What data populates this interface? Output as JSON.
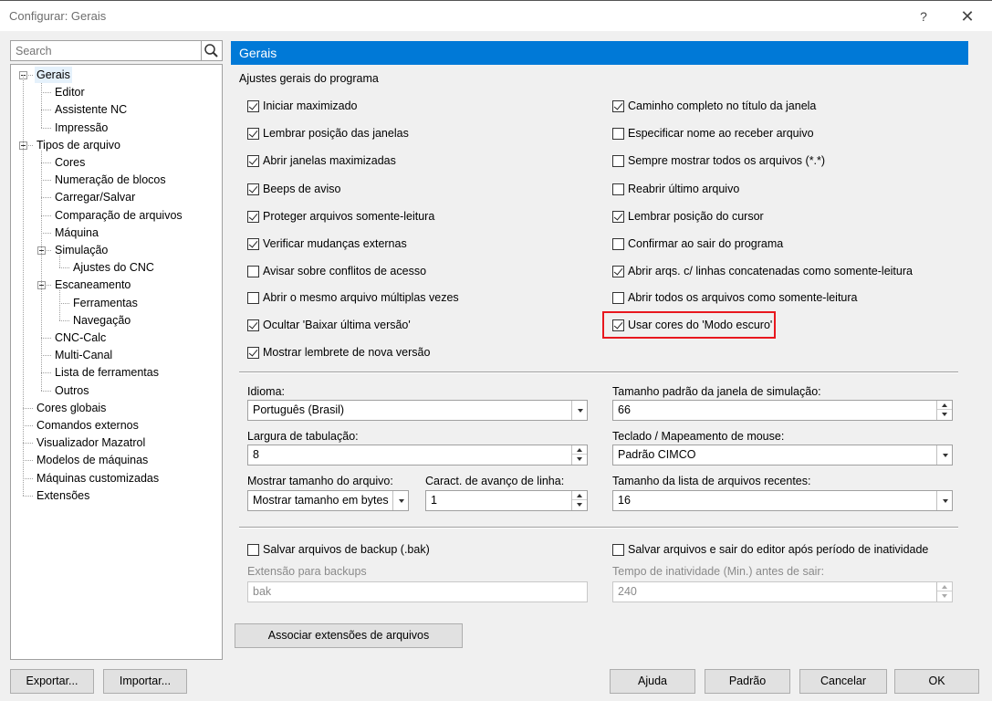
{
  "window": {
    "title": "Configurar: Gerais",
    "help": "?",
    "close": "✕"
  },
  "search": {
    "placeholder": "Search"
  },
  "tree": {
    "items": [
      {
        "label": "Gerais",
        "depth": 0,
        "expander": true,
        "selected": true
      },
      {
        "label": "Editor",
        "depth": 1
      },
      {
        "label": "Assistente NC",
        "depth": 1
      },
      {
        "label": "Impressão",
        "depth": 1
      },
      {
        "label": "Tipos de arquivo",
        "depth": 0,
        "expander": true
      },
      {
        "label": "Cores",
        "depth": 1
      },
      {
        "label": "Numeração de blocos",
        "depth": 1
      },
      {
        "label": "Carregar/Salvar",
        "depth": 1
      },
      {
        "label": "Comparação de arquivos",
        "depth": 1
      },
      {
        "label": "Máquina",
        "depth": 1
      },
      {
        "label": "Simulação",
        "depth": 1,
        "expander": true
      },
      {
        "label": "Ajustes do CNC",
        "depth": 2
      },
      {
        "label": "Escaneamento",
        "depth": 1,
        "expander": true
      },
      {
        "label": "Ferramentas",
        "depth": 2
      },
      {
        "label": "Navegação",
        "depth": 2
      },
      {
        "label": "CNC-Calc",
        "depth": 1
      },
      {
        "label": "Multi-Canal",
        "depth": 1
      },
      {
        "label": "Lista de ferramentas",
        "depth": 1
      },
      {
        "label": "Outros",
        "depth": 1
      },
      {
        "label": "Cores globais",
        "depth": 0
      },
      {
        "label": "Comandos externos",
        "depth": 0
      },
      {
        "label": "Visualizador Mazatrol",
        "depth": 0
      },
      {
        "label": "Modelos de máquinas",
        "depth": 0
      },
      {
        "label": "Máquinas customizadas",
        "depth": 0
      },
      {
        "label": "Extensões",
        "depth": 0
      }
    ]
  },
  "panel": {
    "header": "Gerais",
    "section_label": "Ajustes gerais do programa",
    "left_checks": [
      {
        "label": "Iniciar maximizado",
        "checked": true
      },
      {
        "label": "Lembrar posição das janelas",
        "checked": true
      },
      {
        "label": "Abrir janelas maximizadas",
        "checked": true
      },
      {
        "label": "Beeps de aviso",
        "checked": true
      },
      {
        "label": "Proteger arquivos somente-leitura",
        "checked": true
      },
      {
        "label": "Verificar mudanças externas",
        "checked": true
      },
      {
        "label": "Avisar sobre conflitos de acesso",
        "checked": false
      },
      {
        "label": "Abrir o mesmo arquivo múltiplas vezes",
        "checked": false
      },
      {
        "label": "Ocultar 'Baixar última versão'",
        "checked": true
      },
      {
        "label": "Mostrar lembrete de nova versão",
        "checked": true
      }
    ],
    "right_checks": [
      {
        "label": "Caminho completo no título da janela",
        "checked": true
      },
      {
        "label": "Especificar nome ao receber arquivo",
        "checked": false
      },
      {
        "label": "Sempre mostrar todos os arquivos (*.*)",
        "checked": false
      },
      {
        "label": "Reabrir último arquivo",
        "checked": false
      },
      {
        "label": "Lembrar posição do cursor",
        "checked": true
      },
      {
        "label": "Confirmar ao sair do programa",
        "checked": false
      },
      {
        "label": "Abrir arqs. c/ linhas concatenadas como somente-leitura",
        "checked": true
      },
      {
        "label": "Abrir todos os arquivos como somente-leitura",
        "checked": false
      },
      {
        "label": "Usar cores do 'Modo escuro'",
        "checked": true
      }
    ],
    "idioma": {
      "label": "Idioma:",
      "value": "Português (Brasil)"
    },
    "tab_width": {
      "label": "Largura de tabulação:",
      "value": "8"
    },
    "file_size": {
      "label": "Mostrar tamanho do arquivo:",
      "value": "Mostrar tamanho em bytes"
    },
    "line_feed": {
      "label": "Caract. de avanço de linha:",
      "value": "1"
    },
    "sim_size": {
      "label": "Tamanho padrão da janela de simulação:",
      "value": "66"
    },
    "keyboard": {
      "label": "Teclado / Mapeamento de mouse:",
      "value": "Padrão CIMCO"
    },
    "recent": {
      "label": "Tamanho da lista de arquivos recentes:",
      "value": "16"
    },
    "backup": {
      "label": "Salvar arquivos de backup (.bak)",
      "checked": false,
      "ext_label": "Extensão para backups",
      "ext_value": "bak"
    },
    "autosave": {
      "label": "Salvar arquivos e sair do editor após período de inatividade",
      "checked": false,
      "time_label": "Tempo de inatividade (Min.) antes de sair:",
      "time_value": "240"
    },
    "assoc_button": "Associar extensões de arquivos"
  },
  "footer": {
    "export": "Exportar...",
    "import": "Importar...",
    "help": "Ajuda",
    "default": "Padrão",
    "cancel": "Cancelar",
    "ok": "OK"
  }
}
